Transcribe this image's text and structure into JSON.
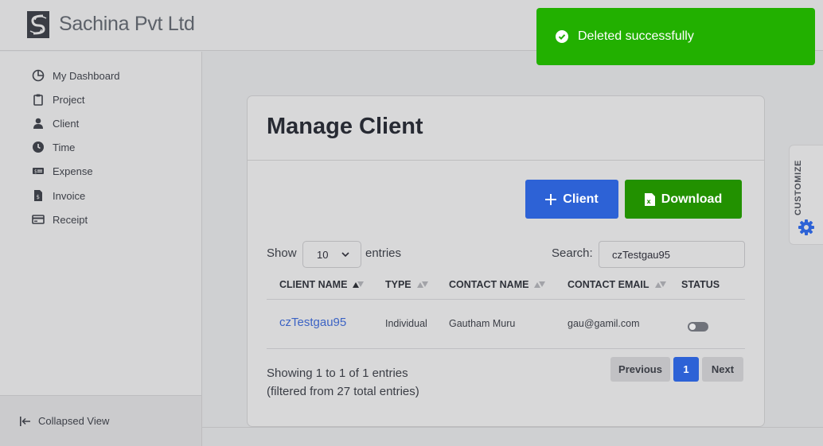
{
  "header": {
    "brand": "Sachina Pvt Ltd"
  },
  "toast": {
    "message": "Deleted successfully"
  },
  "sidebar": {
    "items": [
      {
        "label": "My Dashboard",
        "icon": "pie-chart-icon"
      },
      {
        "label": "Project",
        "icon": "clipboard-icon"
      },
      {
        "label": "Client",
        "icon": "user-icon"
      },
      {
        "label": "Time",
        "icon": "clock-icon"
      },
      {
        "label": "Expense",
        "icon": "money-icon"
      },
      {
        "label": "Invoice",
        "icon": "invoice-icon"
      },
      {
        "label": "Receipt",
        "icon": "receipt-icon"
      }
    ],
    "collapse_label": "Collapsed View"
  },
  "customize": {
    "label": "CUSTOMIZE"
  },
  "main": {
    "title": "Manage Client",
    "add_client_label": "Client",
    "download_label": "Download",
    "show_label": "Show",
    "entries_value": "10",
    "entries_label": "entries",
    "search_label": "Search:",
    "search_value": "czTestgau95",
    "columns": [
      "CLIENT NAME",
      "TYPE",
      "CONTACT NAME",
      "CONTACT EMAIL",
      "STATUS"
    ],
    "rows": [
      {
        "client_name": "czTestgau95",
        "type": "Individual",
        "contact_name": "Gautham Muru",
        "contact_email": "gau@gamil.com",
        "status_active": false
      }
    ],
    "info_line1": "Showing 1 to 1 of 1 entries",
    "info_line2": "(filtered from 27 total entries)",
    "pagination": {
      "previous": "Previous",
      "current": "1",
      "next": "Next"
    }
  },
  "colors": {
    "primary": "#2d62d6",
    "success": "#229100",
    "toast": "#22b000",
    "link": "#3c63c4"
  }
}
